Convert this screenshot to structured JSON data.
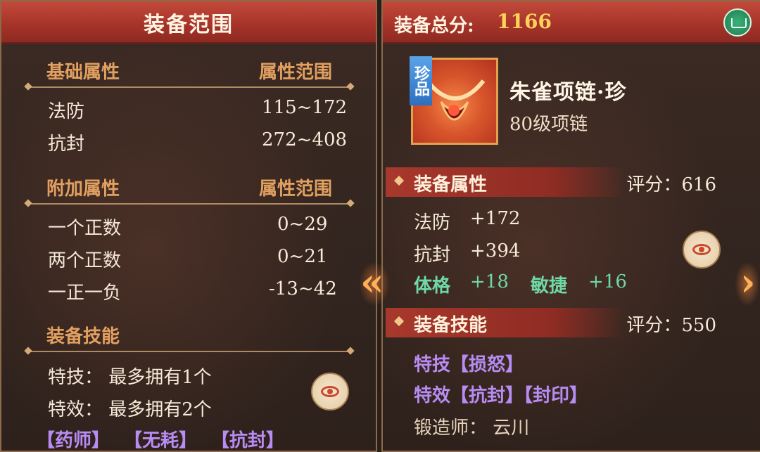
{
  "left": {
    "title": "装备范围",
    "basic": {
      "heading": "基础属性",
      "range_heading": "属性范围",
      "rows": [
        {
          "label": "法防",
          "value": "115~172"
        },
        {
          "label": "抗封",
          "value": "272~408"
        }
      ]
    },
    "extra": {
      "heading": "附加属性",
      "range_heading": "属性范围",
      "rows": [
        {
          "label": "一个正数",
          "value": "0~29"
        },
        {
          "label": "两个正数",
          "value": "0~21"
        },
        {
          "label": "一正一负",
          "value": "-13~42"
        }
      ]
    },
    "skills": {
      "heading": "装备技能",
      "lines": [
        "特技： 最多拥有1个",
        "特效： 最多拥有2个"
      ],
      "tags": [
        "【药师】",
        "【无耗】",
        "【抗封】"
      ]
    }
  },
  "right": {
    "score_label": "装备总分:",
    "score_value": "1166",
    "item": {
      "rarity": "珍品",
      "name": "朱雀项链·珍",
      "subtitle": "80级项链"
    },
    "attrs": {
      "title": "装备属性",
      "score": "评分：616",
      "rows": [
        {
          "label": "法防",
          "value": "+172"
        },
        {
          "label": "抗封",
          "value": "+394"
        }
      ],
      "bonus": [
        {
          "label": "体格",
          "value": "+18"
        },
        {
          "label": "敏捷",
          "value": "+16"
        }
      ]
    },
    "skills": {
      "title": "装备技能",
      "score": "评分：550",
      "tech": "特技【损怒】",
      "effect": "特效【抗封】【封印】",
      "smith": "锻造师： 云川"
    }
  },
  "icons": {
    "left_arrow": "double-chevron-left-icon",
    "right_arrow": "chevron-right-icon",
    "eye": "eye-icon",
    "badge": "box-icon"
  },
  "colors": {
    "header_red": "#b23a2f",
    "gold_heading": "#e2a060",
    "score_gold": "#ffd35a",
    "green": "#6ed9a6",
    "purple": "#b88cf2"
  }
}
